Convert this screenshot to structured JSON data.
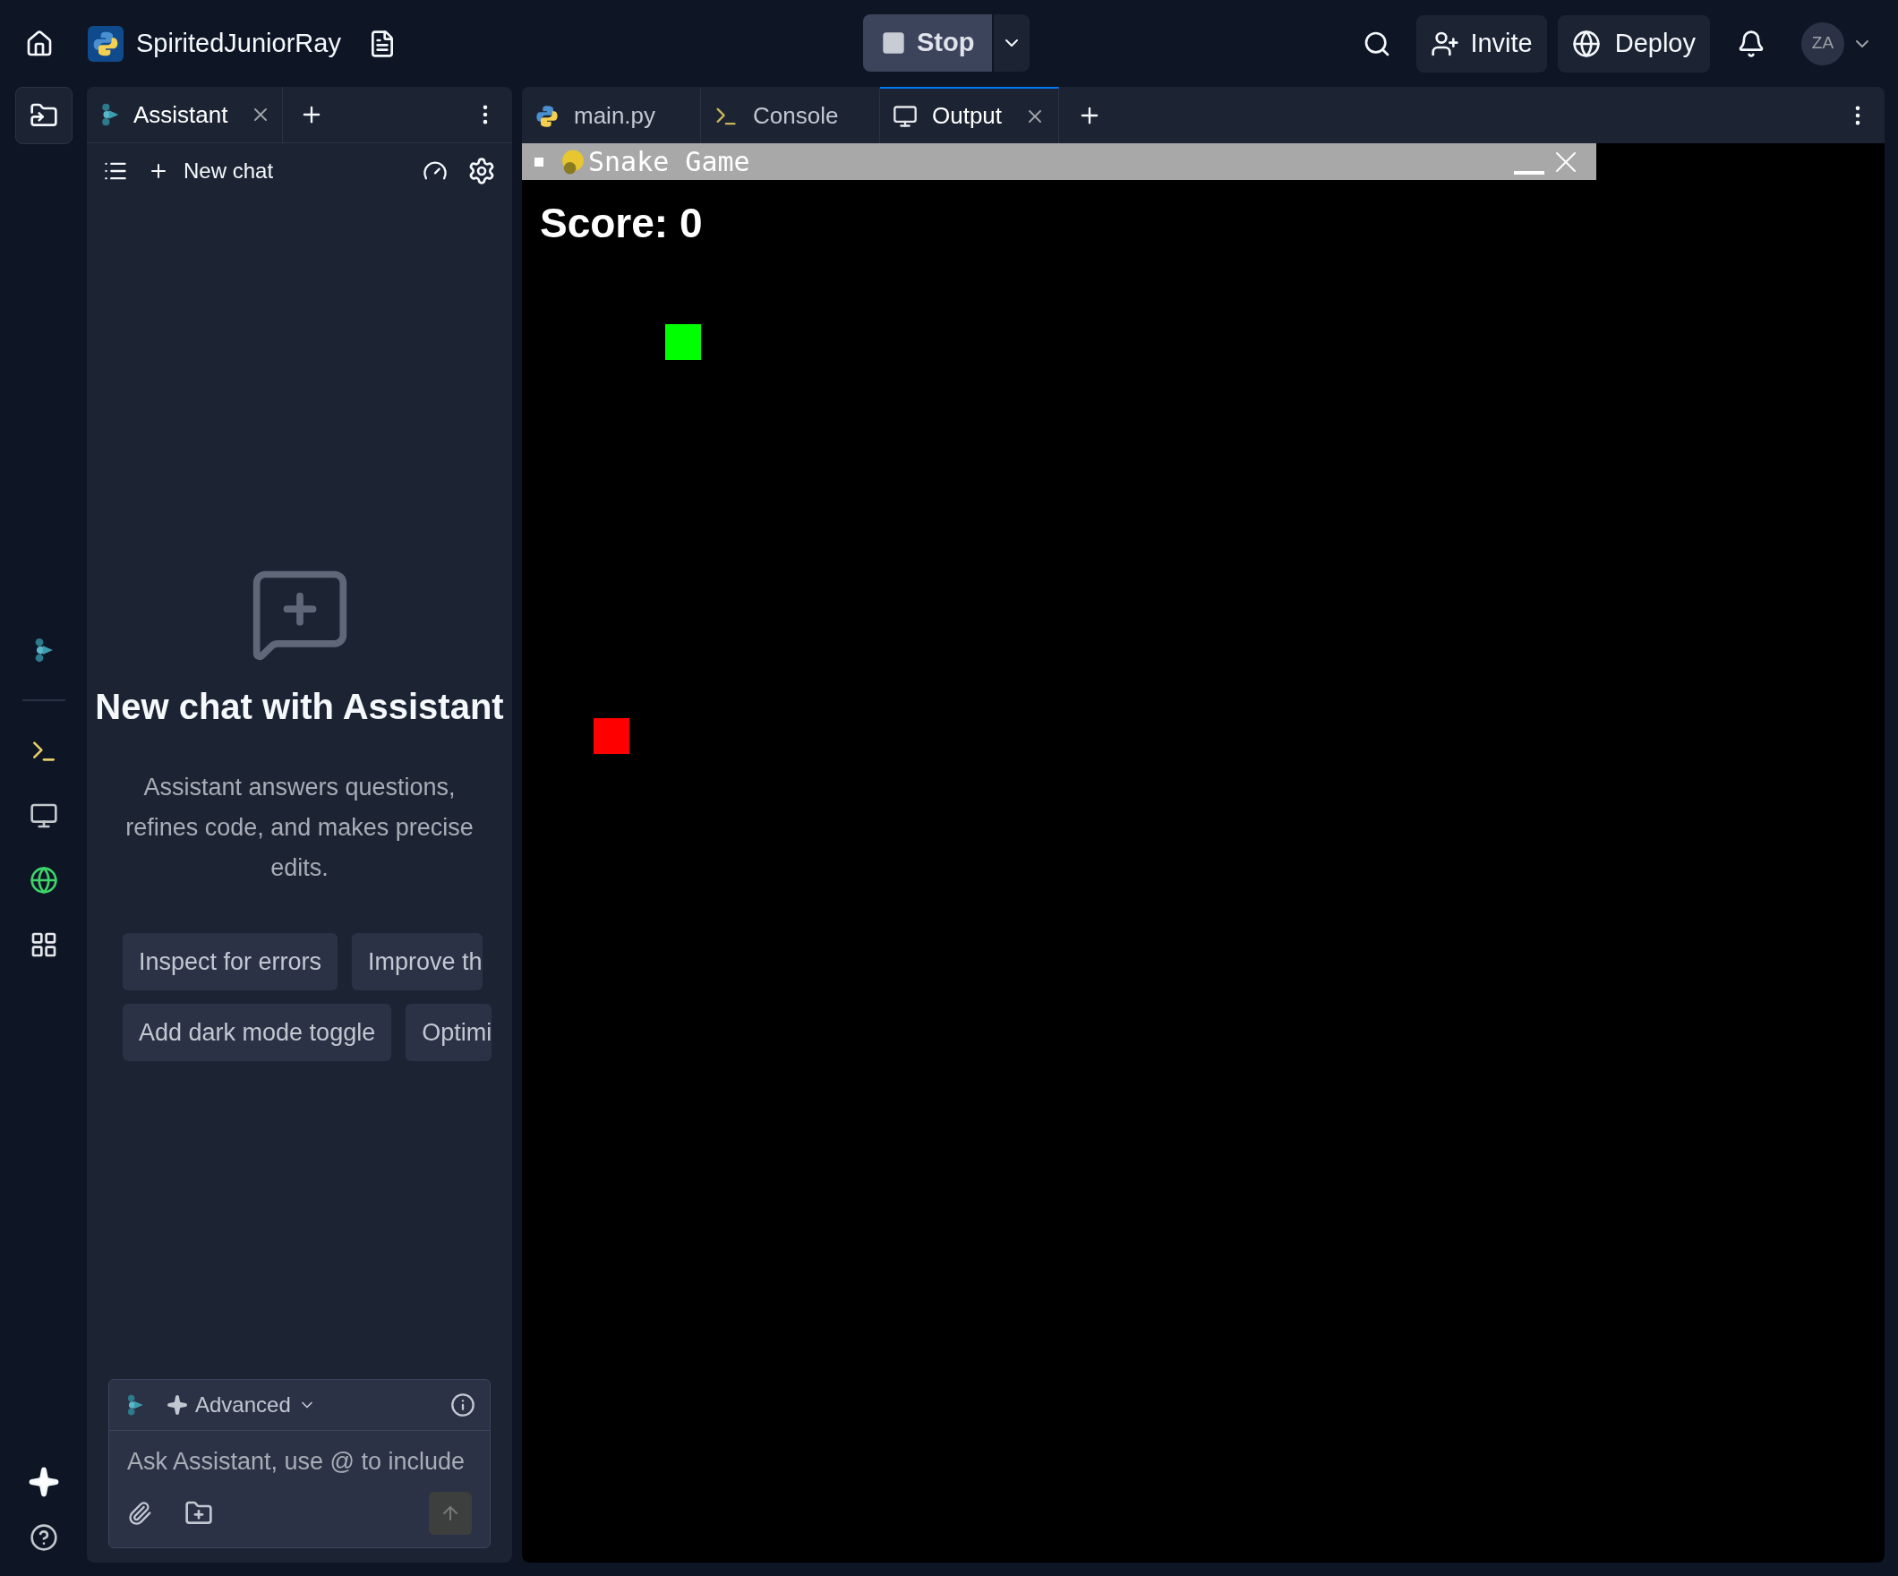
{
  "topbar": {
    "project_name": "SpiritedJuniorRay",
    "run_button": "Stop",
    "invite": "Invite",
    "deploy": "Deploy",
    "avatar": "ZA"
  },
  "side_panel": {
    "tabs": [
      {
        "label": "Assistant",
        "selected": true
      }
    ],
    "new_chat": "New chat",
    "heading": "New chat with Assistant",
    "description": "Assistant answers questions, refines code, and makes precise edits.",
    "suggestions": [
      [
        "Inspect for errors",
        "Improve th"
      ],
      [
        "Add dark mode toggle",
        "Optimi"
      ]
    ],
    "composer": {
      "mode": "Advanced",
      "placeholder": "Ask Assistant, use @ to include"
    }
  },
  "editor": {
    "tabs": [
      {
        "label": "main.py",
        "kind": "file",
        "selected": false
      },
      {
        "label": "Console",
        "kind": "console",
        "selected": false
      },
      {
        "label": "Output",
        "kind": "output",
        "selected": true
      }
    ]
  },
  "game": {
    "title": "Snake Game",
    "score": "Score: 0"
  }
}
